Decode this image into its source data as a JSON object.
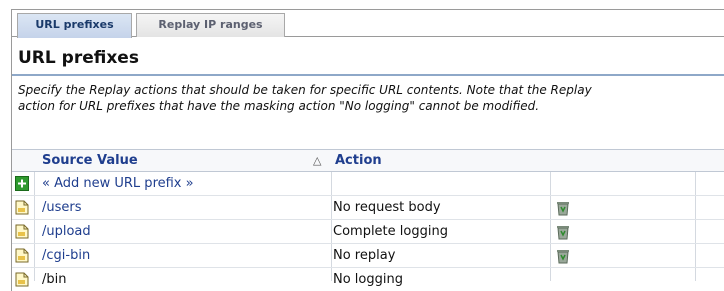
{
  "tabs": [
    {
      "label": "URL prefixes"
    },
    {
      "label": "Replay IP ranges"
    }
  ],
  "page": {
    "title": "URL prefixes",
    "description_line1": "Specify the Replay actions that should be taken for specific URL contents. Note that the Replay",
    "description_line2": "action for URL prefixes that have the masking action \"No logging\" cannot be modified."
  },
  "table": {
    "col_source": "Source Value",
    "col_action": "Action",
    "sort_glyph": "△",
    "add_label": "« Add new URL prefix »",
    "rows": [
      {
        "source": "/users",
        "action": "No request body",
        "deletable": true
      },
      {
        "source": "/upload",
        "action": "Complete logging",
        "deletable": true
      },
      {
        "source": "/cgi-bin",
        "action": "No replay",
        "deletable": true
      },
      {
        "source": "/bin",
        "action": "No logging",
        "deletable": false
      }
    ]
  },
  "icons": {
    "add": "plus-icon",
    "row": "page-icon",
    "delete": "trash-icon"
  },
  "colors": {
    "link": "#1f3e8e",
    "accent_rule": "#8ea8c8",
    "add_green": "#2e9a2e"
  }
}
